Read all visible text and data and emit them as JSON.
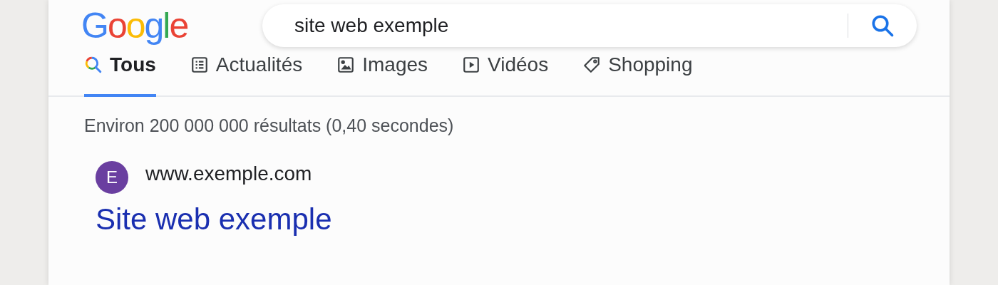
{
  "logo": "Google",
  "search": {
    "value": "site web exemple"
  },
  "tabs": [
    {
      "label": "Tous",
      "kind": "all",
      "selected": true
    },
    {
      "label": "Actualités",
      "kind": "news",
      "selected": false
    },
    {
      "label": "Images",
      "kind": "images",
      "selected": false
    },
    {
      "label": "Vidéos",
      "kind": "videos",
      "selected": false
    },
    {
      "label": "Shopping",
      "kind": "shopping",
      "selected": false
    }
  ],
  "result_stats": "Environ 200 000 000 résultats (0,40 secondes)",
  "results": [
    {
      "favicon": "E",
      "url": "www.exemple.com",
      "title": "Site web exemple"
    }
  ]
}
